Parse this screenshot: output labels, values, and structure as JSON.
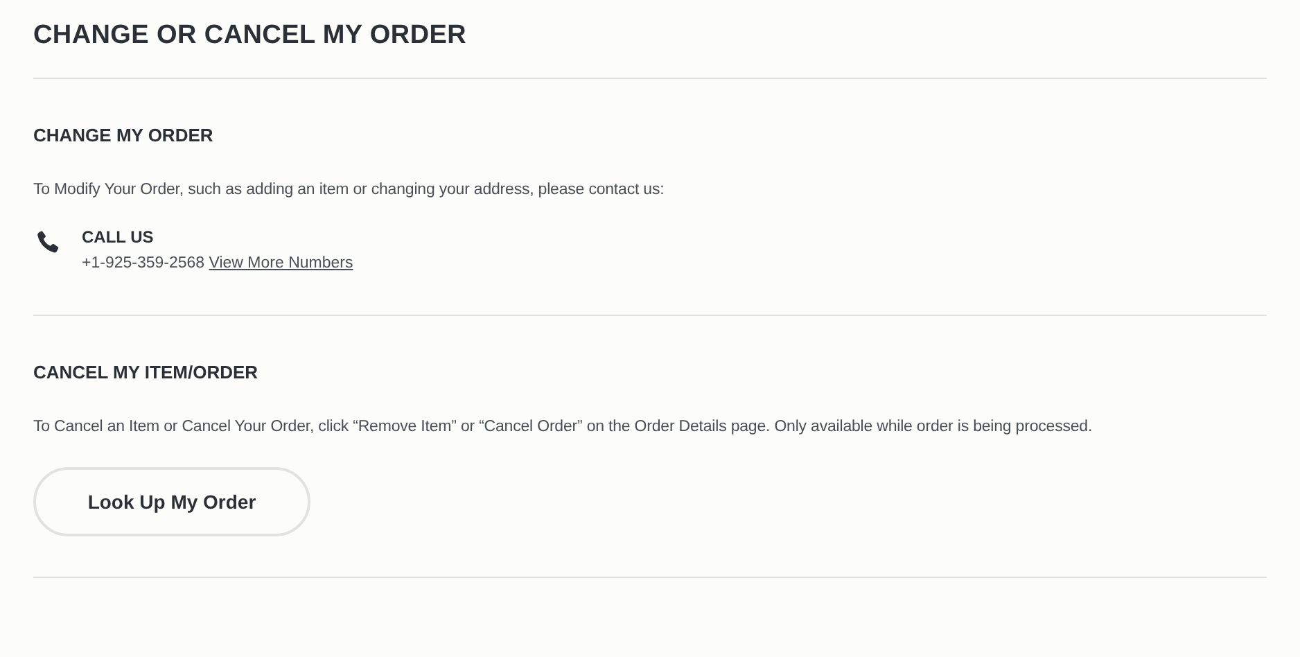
{
  "title": "CHANGE OR CANCEL MY ORDER",
  "sections": [
    {
      "heading": "CHANGE MY ORDER",
      "text": "To Modify Your Order, such as adding an item or changing your address, please contact us:",
      "contact": {
        "label": "CALL US",
        "phone": "+1-925-359-2568",
        "link": "View More Numbers"
      }
    },
    {
      "heading": "CANCEL MY ITEM/ORDER",
      "text": "To Cancel an Item or Cancel Your Order, click “Remove Item” or “Cancel Order” on the Order Details page. Only available while order is being processed.",
      "button": "Look Up My Order"
    }
  ]
}
